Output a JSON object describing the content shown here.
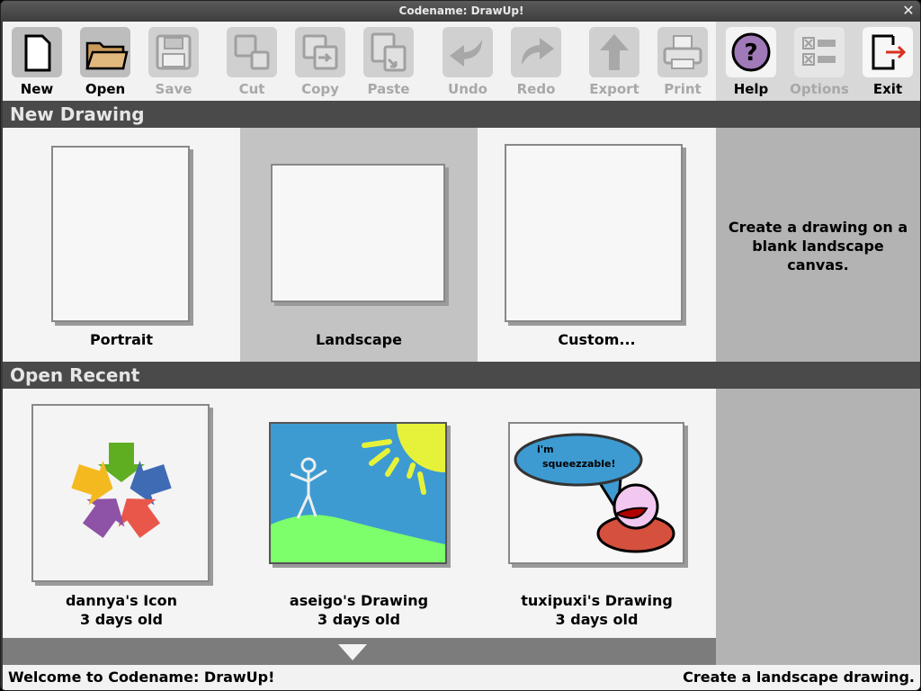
{
  "window": {
    "title": "Codename: DrawUp!",
    "close_glyph": "✕"
  },
  "toolbar": {
    "buttons": [
      {
        "label": "New",
        "icon": "new-document-icon",
        "enabled": true
      },
      {
        "label": "Open",
        "icon": "folder-icon",
        "enabled": true
      },
      {
        "label": "Save",
        "icon": "floppy-disk-icon",
        "enabled": false
      },
      {
        "label": "Cut",
        "icon": "cut-icon",
        "enabled": false
      },
      {
        "label": "Copy",
        "icon": "copy-icon",
        "enabled": false
      },
      {
        "label": "Paste",
        "icon": "paste-icon",
        "enabled": false
      },
      {
        "label": "Undo",
        "icon": "undo-arrow-icon",
        "enabled": false
      },
      {
        "label": "Redo",
        "icon": "redo-arrow-icon",
        "enabled": false
      },
      {
        "label": "Export",
        "icon": "export-arrow-icon",
        "enabled": false
      },
      {
        "label": "Print",
        "icon": "printer-icon",
        "enabled": false
      },
      {
        "label": "Help",
        "icon": "help-question-icon",
        "enabled": true
      },
      {
        "label": "Options",
        "icon": "options-list-icon",
        "enabled": false
      },
      {
        "label": "Exit",
        "icon": "exit-door-icon",
        "enabled": true
      }
    ]
  },
  "new_drawing": {
    "header": "New Drawing",
    "tiles": [
      {
        "label": "Portrait"
      },
      {
        "label": "Landscape",
        "selected": true
      },
      {
        "label": "Custom..."
      }
    ],
    "info": "Create a drawing on a blank landscape canvas."
  },
  "open_recent": {
    "header": "Open Recent",
    "items": [
      {
        "name": "dannya's Icon",
        "age": "3 days old"
      },
      {
        "name": "aseigo's Drawing",
        "age": "3 days old"
      },
      {
        "name": "tuxipuxi's Drawing",
        "age": "3 days old",
        "bubble_line1": "i'm",
        "bubble_line2": "squeezzable!"
      }
    ]
  },
  "scroll": {
    "icon": "scroll-down-triangle-icon"
  },
  "status": {
    "left": "Welcome to Codename: DrawUp!",
    "right": "Create a landscape drawing."
  },
  "colors": {
    "accent_help": "#a079b8",
    "exit_arrow": "#d9301f",
    "sky": "#3d9bd2",
    "sun": "#e6f23a",
    "grass": "#7cff6a"
  }
}
